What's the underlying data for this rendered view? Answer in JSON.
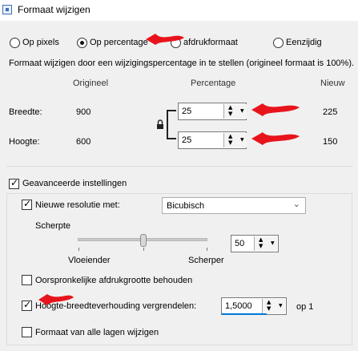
{
  "window": {
    "title": "Formaat wijzigen"
  },
  "mode": {
    "options": [
      {
        "label": "Op pixels",
        "selected": false
      },
      {
        "label": "Op percentage",
        "selected": true
      },
      {
        "label": "afdrukformaat",
        "selected": false
      },
      {
        "label": "Eenzijdig",
        "selected": false
      }
    ],
    "description": "Formaat wijzigen door een wijzigingspercentage in te stellen (origineel formaat  is 100%)."
  },
  "size_table": {
    "col_original": "Origineel",
    "col_percentage": "Percentage",
    "col_new": "Nieuw",
    "rows": [
      {
        "label": "Breedte:",
        "original": "900",
        "percentage": "25",
        "new": "225"
      },
      {
        "label": "Hoogte:",
        "original": "600",
        "percentage": "25",
        "new": "150"
      }
    ]
  },
  "advanced": {
    "label": "Geavanceerde instellingen",
    "checked": true,
    "resolution": {
      "label": "Nieuwe resolutie met:",
      "checked": true,
      "method": "Bicubisch"
    },
    "sharpness": {
      "label": "Scherpte",
      "min_label": "Vloeiender",
      "max_label": "Scherper",
      "value": "50",
      "slider_fraction": 0.5
    },
    "keep_print_size": {
      "label": "Oorspronkelijke afdrukgrootte behouden",
      "checked": false
    },
    "lock_ratio": {
      "label": "Hoogte-breedteverhouding vergrendelen:",
      "checked": true,
      "value": "1,5000",
      "suffix": "op 1"
    },
    "all_layers": {
      "label": "Formaat van alle lagen wijzigen",
      "checked": false
    }
  },
  "colors": {
    "accent": "#0078d7",
    "arrow": "#e8141c"
  }
}
